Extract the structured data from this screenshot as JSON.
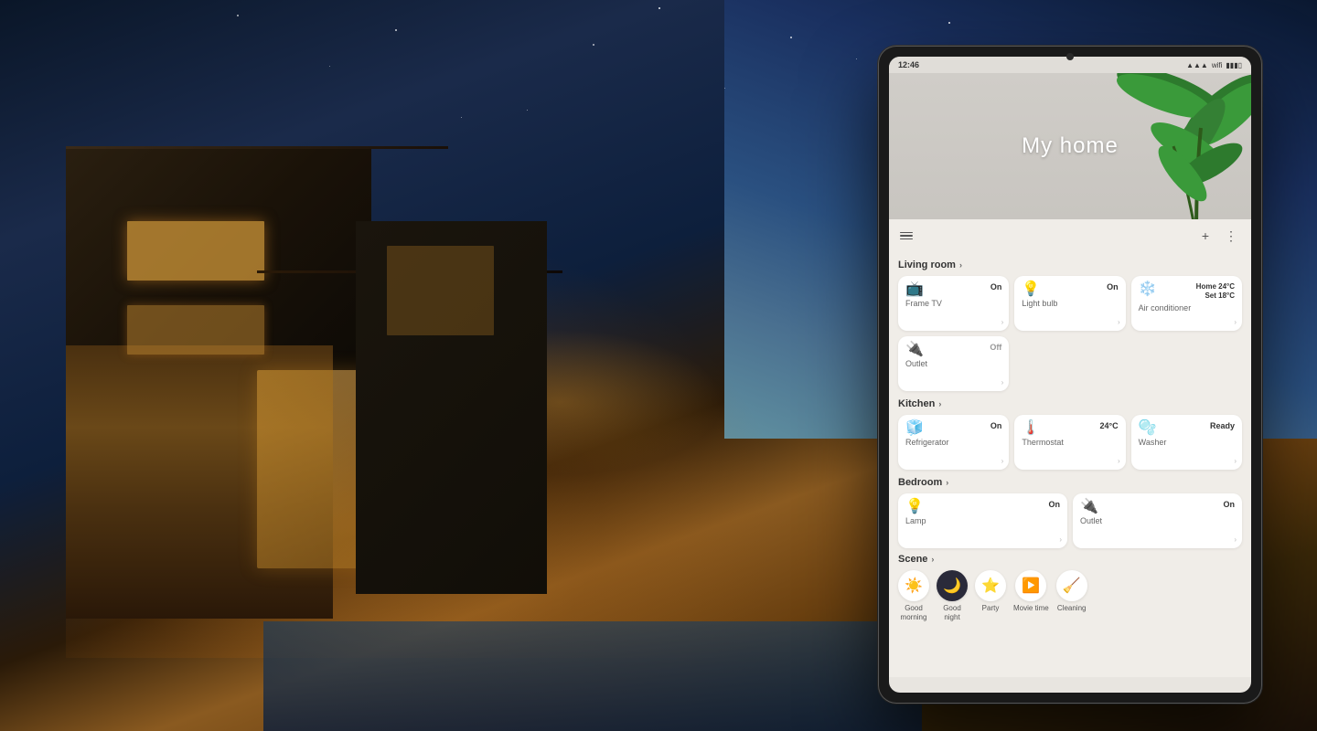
{
  "background": {
    "alt": "Night view of modern house exterior"
  },
  "tablet": {
    "status_bar": {
      "time": "12:46",
      "icons": [
        "signal",
        "wifi",
        "battery"
      ]
    },
    "hero": {
      "title": "My home"
    },
    "controls": {
      "add_label": "+",
      "more_label": "⋮"
    },
    "sections": [
      {
        "id": "living-room",
        "label": "Living room",
        "devices": [
          {
            "id": "frame-tv",
            "icon": "📺",
            "name": "Frame TV",
            "status": "On",
            "status_type": "on"
          },
          {
            "id": "light-bulb",
            "icon": "💡",
            "name": "Light bulb",
            "status": "On",
            "status_type": "on"
          },
          {
            "id": "air-conditioner",
            "icon": "❄️",
            "name": "Air conditioner",
            "status": "Home 24°C\nSet 18°C",
            "status_type": "ac"
          },
          {
            "id": "outlet-living",
            "icon": "🔌",
            "name": "Outlet",
            "status": "Off",
            "status_type": "off"
          }
        ]
      },
      {
        "id": "kitchen",
        "label": "Kitchen",
        "devices": [
          {
            "id": "refrigerator",
            "icon": "🧊",
            "name": "Refrigerator",
            "status": "On",
            "status_type": "on"
          },
          {
            "id": "thermostat",
            "icon": "🌡️",
            "name": "Thermostat",
            "status": "24°C",
            "status_type": "temp"
          },
          {
            "id": "washer",
            "icon": "🫧",
            "name": "Washer",
            "status": "Ready",
            "status_type": "ready"
          }
        ]
      },
      {
        "id": "bedroom",
        "label": "Bedroom",
        "devices": [
          {
            "id": "lamp-bedroom",
            "icon": "💡",
            "name": "Lamp",
            "status": "On",
            "status_type": "on"
          },
          {
            "id": "outlet-bedroom",
            "icon": "🔌",
            "name": "Outlet",
            "status": "On",
            "status_type": "on"
          }
        ]
      },
      {
        "id": "scene",
        "label": "Scene",
        "scenes": [
          {
            "id": "good-morning",
            "icon": "☀️",
            "label": "Good\nmorning"
          },
          {
            "id": "good-night",
            "icon": "🌙",
            "label": "Good\nnight"
          },
          {
            "id": "party",
            "icon": "⭐",
            "label": "Party"
          },
          {
            "id": "movie-time",
            "icon": "▶️",
            "label": "Movie time"
          },
          {
            "id": "cleaning",
            "icon": "🧹",
            "label": "Cleaning"
          }
        ]
      }
    ]
  }
}
